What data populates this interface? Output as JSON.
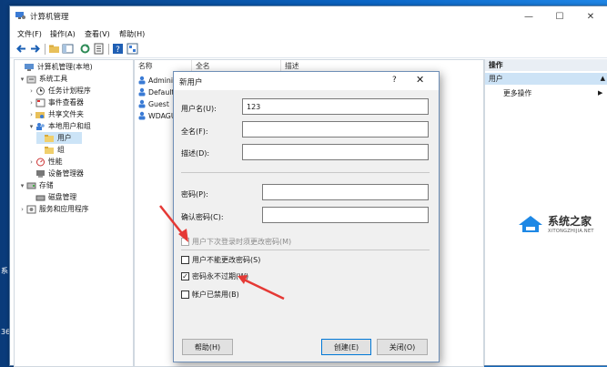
{
  "window": {
    "title": "计算机管理",
    "minimize": "—",
    "maximize": "☐",
    "close": "✕"
  },
  "menu": [
    "文件(F)",
    "操作(A)",
    "查看(V)",
    "帮助(H)"
  ],
  "tree": [
    {
      "label": "计算机管理(本地)",
      "twisty": ""
    },
    {
      "label": "系统工具",
      "twisty": "▾"
    },
    {
      "label": "任务计划程序",
      "twisty": "›"
    },
    {
      "label": "事件查看器",
      "twisty": "›"
    },
    {
      "label": "共享文件夹",
      "twisty": "›"
    },
    {
      "label": "本地用户和组",
      "twisty": "▾"
    },
    {
      "label": "用户",
      "twisty": ""
    },
    {
      "label": "组",
      "twisty": ""
    },
    {
      "label": "性能",
      "twisty": "›"
    },
    {
      "label": "设备管理器",
      "twisty": ""
    },
    {
      "label": "存储",
      "twisty": "▾"
    },
    {
      "label": "磁盘管理",
      "twisty": ""
    },
    {
      "label": "服务和应用程序",
      "twisty": "›"
    }
  ],
  "list": {
    "columns": [
      "名称",
      "全名",
      "描述"
    ],
    "rows": [
      "Administr",
      "DefaultAc",
      "Guest",
      "WDAGUti"
    ]
  },
  "actions": {
    "header": "操作",
    "selected": "用户",
    "more": "更多操作",
    "caret": "▲",
    "more_caret": "▶"
  },
  "dialog": {
    "title": "新用户",
    "help": "?",
    "close": "✕",
    "username_label": "用户名(U):",
    "username_value": "123",
    "fullname_label": "全名(F):",
    "fullname_value": "",
    "desc_label": "描述(D):",
    "desc_value": "",
    "password_label": "密码(P):",
    "confirm_label": "确认密码(C):",
    "checkboxes": [
      {
        "label": "用户下次登录时须更改密码(M)",
        "checked": false,
        "disabled": true
      },
      {
        "label": "用户不能更改密码(S)",
        "checked": false,
        "disabled": false
      },
      {
        "label": "密码永不过期(W)",
        "checked": true,
        "disabled": false
      },
      {
        "label": "帐户已禁用(B)",
        "checked": false,
        "disabled": false
      }
    ],
    "help_button": "帮助(H)",
    "create_button": "创建(E)",
    "close_button": "关闭(O)"
  },
  "watermark": {
    "title": "系统之家",
    "subtitle": "XITONGZHIJIA.NET"
  },
  "desktop_edge": [
    "系",
    "360"
  ],
  "colors": {
    "accent": "#0078d7",
    "arrow": "#e53935",
    "selection": "#cce4f7"
  }
}
